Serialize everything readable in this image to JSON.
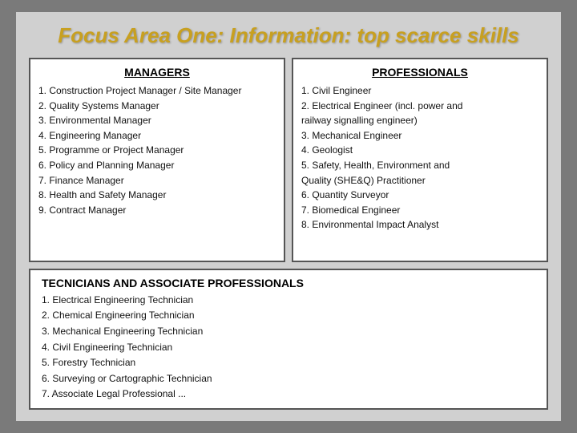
{
  "title": "Focus Area One: Information: top scarce skills",
  "managers": {
    "heading": "MANAGERS",
    "items": [
      "1.  Construction Project Manager / Site Manager",
      "2.  Quality Systems Manager",
      "3.  Environmental Manager",
      "4.  Engineering Manager",
      "5.  Programme or Project Manager",
      "6.  Policy and Planning Manager",
      "7.  Finance Manager",
      "8.  Health and Safety Manager",
      "9.  Contract Manager"
    ]
  },
  "professionals": {
    "heading": "PROFESSIONALS",
    "items": [
      "1.  Civil Engineer",
      "2.  Electrical Engineer (incl. power and",
      "     railway signalling engineer)",
      "3.  Mechanical Engineer",
      "4.  Geologist",
      "5.  Safety, Health, Environment and",
      "     Quality (SHE&Q) Practitioner",
      "6.  Quantity Surveyor",
      "7.  Biomedical Engineer",
      "8.  Environmental Impact Analyst"
    ]
  },
  "technicians": {
    "heading": "TECNICIANS AND ASSOCIATE PROFESSIONALS",
    "items": [
      "1. Electrical Engineering Technician",
      "2. Chemical Engineering Technician",
      "3. Mechanical Engineering Technician",
      "4. Civil Engineering Technician",
      "5. Forestry Technician",
      "6. Surveying or Cartographic Technician",
      "7. Associate Legal Professional  ..."
    ]
  }
}
